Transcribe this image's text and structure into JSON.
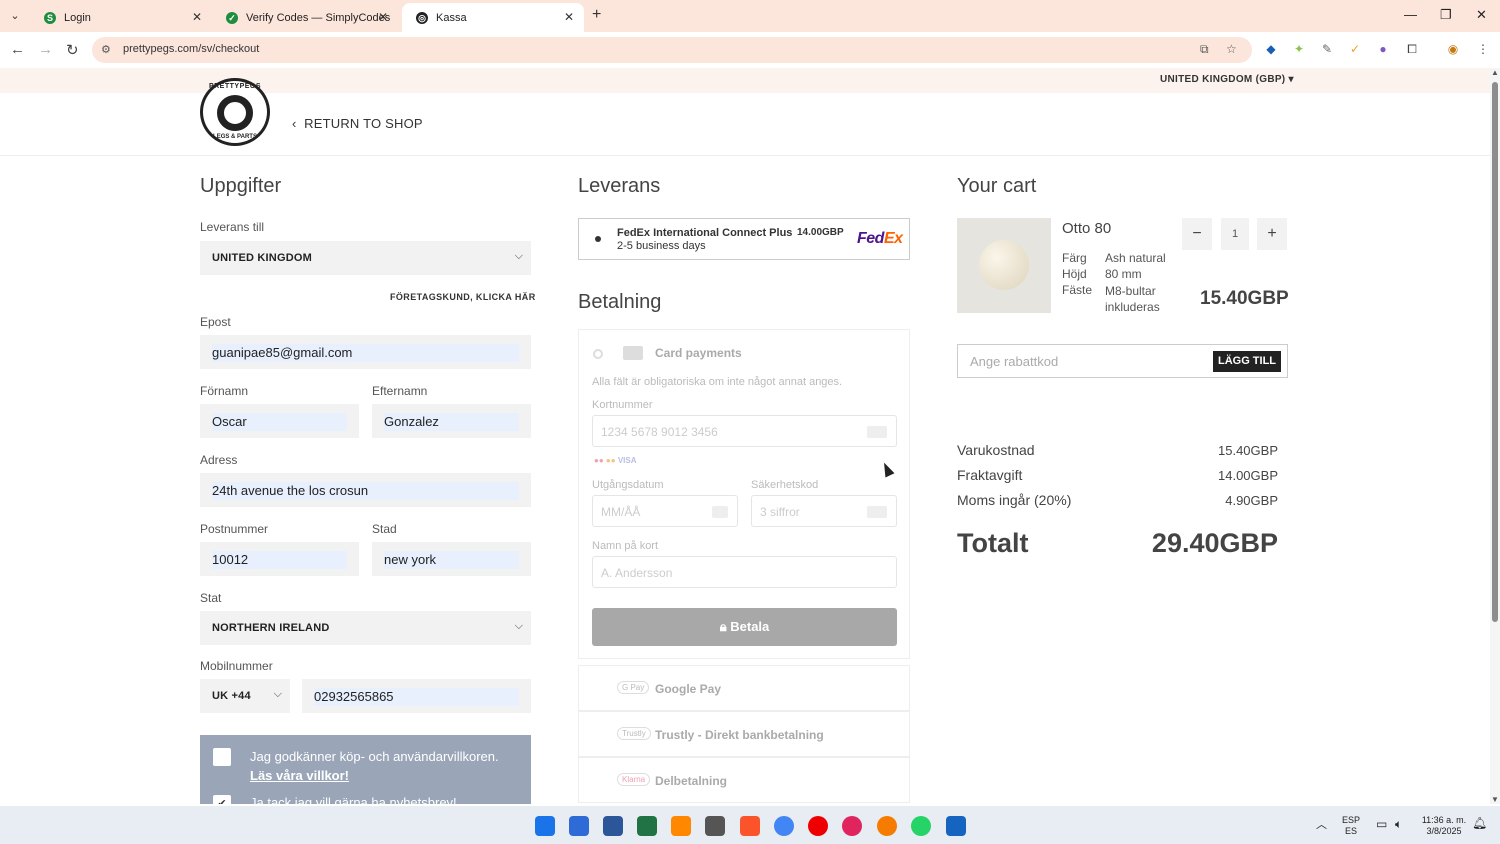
{
  "browser": {
    "tabs": [
      {
        "title": "Login",
        "favicon": "S",
        "color": "#1e8e3e"
      },
      {
        "title": "Verify Codes — SimplyCodes",
        "favicon": "✓",
        "color": "#1e8e3e"
      },
      {
        "title": "Kassa",
        "favicon": "◎",
        "color": "#222"
      }
    ],
    "url": "prettypegs.com/sv/checkout"
  },
  "site": {
    "currency": "UNITED KINGDOM (GBP) ▾",
    "logo_top": "PRETTYPEGS",
    "logo_bottom": "LEGS & PARTS",
    "return": "RETURN TO SHOP"
  },
  "details": {
    "heading": "Uppgifter",
    "ship_to_label": "Leverans till",
    "ship_to": "UNITED KINGDOM",
    "corporate": "FÖRETAGSKUND, KLICKA HÄR",
    "email_label": "Epost",
    "email": "guanipae85@gmail.com",
    "first_label": "Förnamn",
    "first": "Oscar",
    "last_label": "Efternamn",
    "last": "Gonzalez",
    "address_label": "Adress",
    "address": "24th avenue the los crosun",
    "zip_label": "Postnummer",
    "zip": "10012",
    "city_label": "Stad",
    "city": "new york",
    "state_label": "Stat",
    "state": "NORTHERN IRELAND",
    "phone_label": "Mobilnummer",
    "phone_code": "UK +44",
    "phone": "02932565865",
    "terms_text": "Jag godkänner köp- och användarvillkoren.",
    "terms_link": "Läs våra villkor!",
    "newsletter": "Ja tack jag vill gärna ha nyhetsbrev!"
  },
  "delivery": {
    "heading": "Leverans",
    "option_name": "FedEx International Connect Plus",
    "option_days": "2-5 business days",
    "option_price": "14.00GBP",
    "carrier": "FedEx"
  },
  "payment": {
    "heading": "Betalning",
    "card_title": "Card payments",
    "required_note": "Alla fält är obligatoriska om inte något annat anges.",
    "card_number_label": "Kortnummer",
    "card_number_ph": "1234 5678 9012 3456",
    "expiry_label": "Utgångsdatum",
    "expiry_ph": "MM/ÅÅ",
    "cvc_label": "Säkerhetskod",
    "cvc_ph": "3 siffror",
    "name_label": "Namn på kort",
    "name_ph": "A. Andersson",
    "pay_button": "Betala",
    "alt": [
      {
        "logo": "G Pay",
        "name": "Google Pay"
      },
      {
        "logo": "Trustly",
        "name": "Trustly - Direkt bankbetalning"
      },
      {
        "logo": "Klarna",
        "name": "Delbetalning"
      }
    ]
  },
  "cart": {
    "heading": "Your cart",
    "product": "Otto 80",
    "qty": "1",
    "attrs": [
      {
        "k": "Färg",
        "v": "Ash natural"
      },
      {
        "k": "Höjd",
        "v": "80 mm"
      },
      {
        "k": "Fäste",
        "v": "M8-bultar inkluderas"
      }
    ],
    "price": "15.40GBP",
    "coupon_ph": "Ange rabattkod",
    "coupon_btn": "LÄGG TILL",
    "subtotal_label": "Varukostnad",
    "subtotal": "15.40GBP",
    "shipping_label": "Fraktavgift",
    "shipping": "14.00GBP",
    "vat_label": "Moms ingår (20%)",
    "vat": "4.90GBP",
    "total_label": "Totalt",
    "total": "29.40GBP"
  },
  "taskbar": {
    "lang1": "ESP",
    "lang2": "ES",
    "time": "11:36 a. m.",
    "date": "3/8/2025"
  }
}
